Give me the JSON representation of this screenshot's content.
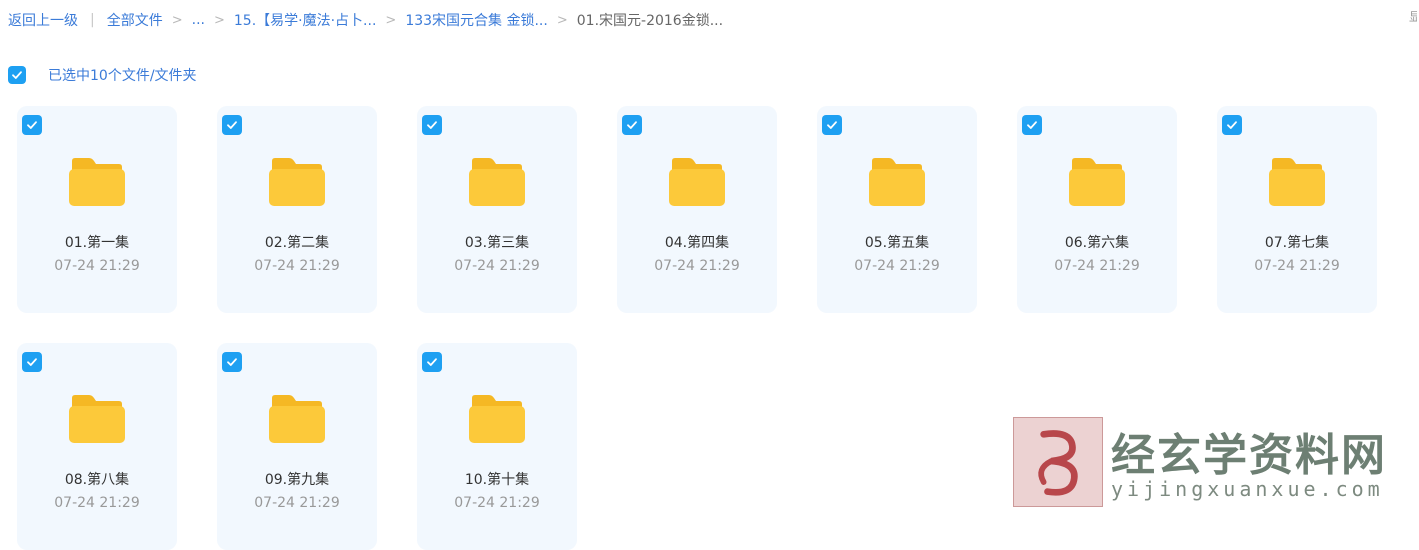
{
  "breadcrumb": {
    "back": "返回上一级",
    "all_files": "全部文件",
    "ellipsis": "...",
    "level1": "15.【易学·魔法·占卜...",
    "level2": "133宋国元合集 金锁...",
    "current": "01.宋国元-2016金锁..."
  },
  "selection": {
    "label": "已选中10个文件/文件夹",
    "checked": true
  },
  "folders": [
    {
      "name": "01.第一集",
      "date": "07-24 21:29",
      "checked": true
    },
    {
      "name": "02.第二集",
      "date": "07-24 21:29",
      "checked": true
    },
    {
      "name": "03.第三集",
      "date": "07-24 21:29",
      "checked": true
    },
    {
      "name": "04.第四集",
      "date": "07-24 21:29",
      "checked": true
    },
    {
      "name": "05.第五集",
      "date": "07-24 21:29",
      "checked": true
    },
    {
      "name": "06.第六集",
      "date": "07-24 21:29",
      "checked": true
    },
    {
      "name": "07.第七集",
      "date": "07-24 21:29",
      "checked": true
    },
    {
      "name": "08.第八集",
      "date": "07-24 21:29",
      "checked": true
    },
    {
      "name": "09.第九集",
      "date": "07-24 21:29",
      "checked": true
    },
    {
      "name": "10.第十集",
      "date": "07-24 21:29",
      "checked": true
    }
  ],
  "watermark": {
    "title": "经玄学资料网",
    "url": "yijingxuanxue.com",
    "logo_char": "易"
  },
  "colors": {
    "accent": "#1ea0f2",
    "link": "#3b7bd8",
    "card_bg": "#f2f8fe",
    "folder": "#fcc93a"
  }
}
